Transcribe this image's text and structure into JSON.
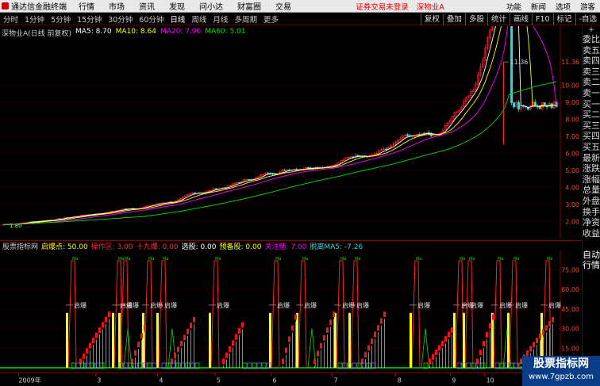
{
  "menubar": {
    "app_name": "通达信金融终端",
    "items": [
      "行情",
      "市场",
      "资讯",
      "发现",
      "问小达",
      "财富圈",
      "交易"
    ],
    "notice": "证券交易未登录",
    "stock": "深物业A",
    "sys_items": [
      "功能",
      "新闻",
      "选项",
      "游客"
    ]
  },
  "periodbar": {
    "periods": [
      "分时",
      "1分钟",
      "5分钟",
      "15分钟",
      "30分钟",
      "60分钟",
      "日线",
      "周线",
      "月线",
      "多周期",
      "更多"
    ],
    "active": "日线",
    "tools": [
      "复权",
      "叠加",
      "多股",
      "统计",
      "画线",
      "F10",
      "标记",
      "-自选"
    ]
  },
  "main_header": {
    "title": "深物业A(日线 前复权)",
    "ma5": "MA5: 8.70",
    "ma10": "MA10: 8.64",
    "ma20": "MA20: 7.96",
    "ma60": "MA60: 5.01"
  },
  "main_chart": {
    "price_labels": [
      "11.36",
      "10.00",
      "9.00",
      "8.00",
      "7.00",
      "6.00",
      "5.00",
      "4.00",
      "3.00",
      "2.00"
    ],
    "low_label": "1.80",
    "peak_label": "11.36"
  },
  "sidebar": {
    "top": "+",
    "items": [
      "委比",
      "卖五",
      "卖四",
      "卖三",
      "卖二",
      "卖一",
      "买一",
      "买二",
      "买三",
      "买四",
      "买五",
      "最新",
      "涨跌",
      "涨幅",
      "总量",
      "外盘",
      "换手",
      "净资",
      "收益",
      "",
      "自动",
      "行情"
    ]
  },
  "ind_header": {
    "name": "股票指标网",
    "qidian": "启爆点: 50.00",
    "caozuo": "操作区: 3.00",
    "shijiu": "十九爆: 0.00",
    "xuangu": "选股: 0.00",
    "yubei": "预备股: 0.00",
    "guanzhu": "关注赌: 7.00",
    "tuoli": "脱离MA5: -7.26"
  },
  "ind_chart": {
    "y_labels": [
      "75.00",
      "60.00",
      "45.00",
      "30.00",
      "15.00"
    ],
    "burst_label": "启爆",
    "mark_label": "Ma"
  },
  "date_axis": {
    "labels": [
      "2009年",
      "3",
      "4",
      "5",
      "6",
      "7",
      "8",
      "9",
      "10",
      "1"
    ]
  },
  "watermark": {
    "title": "股票指标网",
    "url": "www.7gpzb.com"
  },
  "colors": {
    "up": "#ff2020",
    "down": "#30d8e0",
    "ma5": "#ffffff",
    "ma10": "#ffff00",
    "ma20": "#ff00ff",
    "ma60": "#00e000",
    "bar_yellow": "#ffff00",
    "bar_purple": "#a040ff",
    "grid": "#8a0000"
  }
}
